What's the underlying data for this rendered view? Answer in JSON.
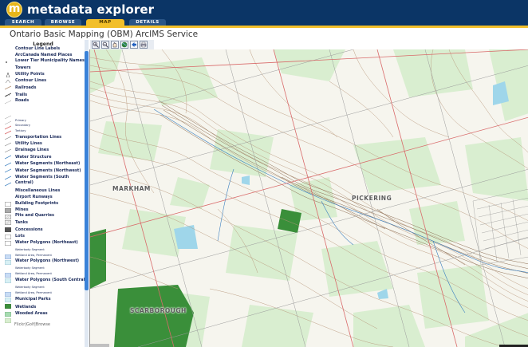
{
  "app": {
    "logo_letter": "m",
    "title": "metadata explorer"
  },
  "nav": {
    "tabs": [
      {
        "label": "SEARCH",
        "active": false
      },
      {
        "label": "BROWSE",
        "active": false
      },
      {
        "label": "MAP",
        "active": true
      },
      {
        "label": "DETAILS",
        "active": false
      }
    ]
  },
  "page": {
    "title": "Ontario Basic Mapping (OBM) ArcIMS Service"
  },
  "legend": {
    "title": "Legend",
    "items": [
      {
        "label": "Contour Line Labels",
        "style": "bold",
        "symbol": "none"
      },
      {
        "label": "ArcCanada Named Places",
        "style": "bold",
        "symbol": "dot"
      },
      {
        "label": "Lower Tier Municipality Names",
        "style": "bold",
        "symbol": "none"
      },
      {
        "label": "Towers",
        "style": "bold",
        "symbol": "tower"
      },
      {
        "label": "Utility Points",
        "style": "bold",
        "symbol": "point"
      },
      {
        "label": "Contour Lines",
        "style": "bold",
        "symbol": "line-brown"
      },
      {
        "label": "Railroads",
        "style": "bold",
        "symbol": "line-rail"
      },
      {
        "label": "Trails",
        "style": "bold",
        "symbol": "line-dash"
      },
      {
        "label": "Roads",
        "style": "bold",
        "symbol": "none"
      },
      {
        "label": "",
        "style": "small",
        "symbol": "line-thin"
      },
      {
        "label": "",
        "style": "small",
        "symbol": "line-thin"
      },
      {
        "label": "Primary",
        "style": "small",
        "symbol": "line-red"
      },
      {
        "label": "Secondary",
        "style": "small",
        "symbol": "line-red"
      },
      {
        "label": "Tertiary",
        "style": "small",
        "symbol": "line-grey"
      },
      {
        "label": "Transportation Lines",
        "style": "bold",
        "symbol": "line-grey"
      },
      {
        "label": "Utility Lines",
        "style": "bold",
        "symbol": "line-grey"
      },
      {
        "label": "Drainage Lines",
        "style": "bold",
        "symbol": "line-blue"
      },
      {
        "label": "Water Structure",
        "style": "bold",
        "symbol": "line-blue"
      },
      {
        "label": "Water Segments (Northeast)",
        "style": "bold",
        "symbol": "line-blue"
      },
      {
        "label": "Water Segments (Northwest)",
        "style": "bold",
        "symbol": "line-blue"
      },
      {
        "label": "Water Segments (South",
        "style": "bold",
        "symbol": "line-blue"
      },
      {
        "label": "Central)",
        "style": "bold",
        "symbol": "none"
      },
      {
        "label": "Miscellaneous Lines",
        "style": "bold",
        "symbol": "none"
      },
      {
        "label": "Airport Runways",
        "style": "bold",
        "symbol": "box-white"
      },
      {
        "label": "Building Footprints",
        "style": "bold",
        "symbol": "box-grey"
      },
      {
        "label": "Mines",
        "style": "bold",
        "symbol": "box-hatch"
      },
      {
        "label": "Pits and Quarries",
        "style": "bold",
        "symbol": "box-hatch"
      },
      {
        "label": "Tanks",
        "style": "bold",
        "symbol": "box-dark"
      },
      {
        "label": "Concessions",
        "style": "bold",
        "symbol": "box-white"
      },
      {
        "label": "Lots",
        "style": "bold",
        "symbol": "box-white"
      },
      {
        "label": "Water Polygons (Northeast)",
        "style": "bold",
        "symbol": "none"
      },
      {
        "label": "Waterbody Segment",
        "style": "small",
        "symbol": "box-lightblue"
      },
      {
        "label": "Wetland Area, Permanent",
        "style": "small",
        "symbol": "box-wetland"
      },
      {
        "label": "Water Polygons (Northwest)",
        "style": "bold",
        "symbol": "none"
      },
      {
        "label": "Waterbody Segment",
        "style": "small",
        "symbol": "box-lightblue"
      },
      {
        "label": "Wetland Area, Permanent",
        "style": "small",
        "symbol": "box-wetland"
      },
      {
        "label": "Water Polygons (South Central)",
        "style": "bold",
        "symbol": "none"
      },
      {
        "label": "Waterbody Segment",
        "style": "small",
        "symbol": "box-lightblue"
      },
      {
        "label": "Wetland Area, Permanent",
        "style": "small",
        "symbol": "box-wetland"
      },
      {
        "label": "Municipal Parks",
        "style": "bold",
        "symbol": "box-park"
      },
      {
        "label": "Wetlands",
        "style": "bold",
        "symbol": "box-green"
      },
      {
        "label": "Wooded Areas",
        "style": "bold",
        "symbol": "box-wood"
      }
    ],
    "credit": "Flickr|Golf|Browse"
  },
  "toolbar": {
    "tools": [
      {
        "icon": "zoom-in-icon"
      },
      {
        "icon": "zoom-out-icon"
      },
      {
        "icon": "pan-hand-icon"
      },
      {
        "icon": "globe-icon"
      },
      {
        "icon": "back-arrow-icon"
      },
      {
        "icon": "print-icon"
      }
    ]
  },
  "map": {
    "place_labels": [
      "MARKHAM",
      "PICKERING",
      "SCARBOROUGH"
    ]
  },
  "colors": {
    "header_bg": "#0b3566",
    "accent": "#f2bf2a",
    "wooded": "#d9eed0",
    "park": "#3a8f3a",
    "water": "#9fd6ea",
    "road": "#d96a6a",
    "contour": "#b8967a"
  }
}
